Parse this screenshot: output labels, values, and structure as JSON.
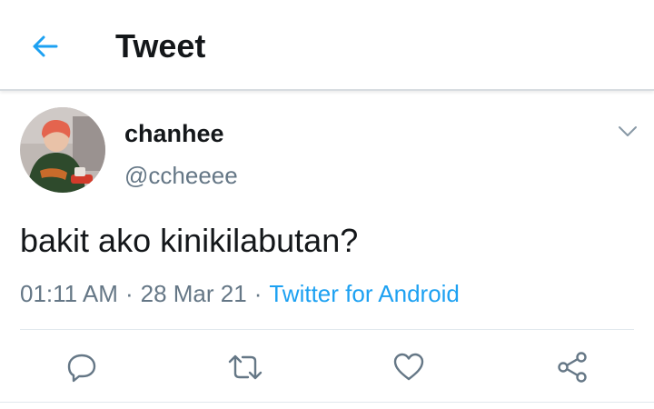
{
  "header": {
    "title": "Tweet",
    "back_icon": "back-arrow-icon"
  },
  "tweet": {
    "display_name": "chanhee",
    "handle": "@ccheeee",
    "text": "bakit ako kinikilabutan?",
    "time": "01:11 AM",
    "date": "28 Mar 21",
    "source": "Twitter for Android",
    "separator": "·"
  },
  "actions": {
    "reply_icon": "reply-icon",
    "retweet_icon": "retweet-icon",
    "like_icon": "heart-icon",
    "share_icon": "share-icon"
  },
  "colors": {
    "accent": "#1da1f2",
    "text": "#14171a",
    "muted": "#657786",
    "icon": "#657786"
  }
}
